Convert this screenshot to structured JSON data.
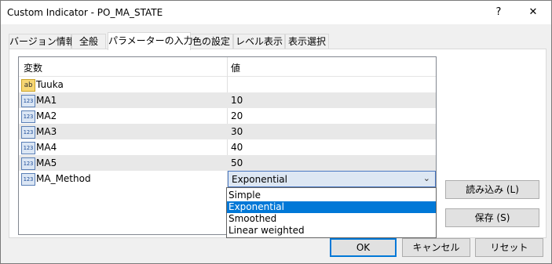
{
  "window": {
    "title": "Custom Indicator - PO_MA_STATE",
    "help_label": "?",
    "close_label": "✕"
  },
  "tabs": [
    {
      "label": "バージョン情報"
    },
    {
      "label": "全般"
    },
    {
      "label": "パラメーターの入力"
    },
    {
      "label": "色の設定"
    },
    {
      "label": "レベル表示"
    },
    {
      "label": "表示選択"
    }
  ],
  "grid": {
    "header_name": "変数",
    "header_value": "値",
    "rows": [
      {
        "icon": "ab",
        "name": "Tuuka",
        "value": ""
      },
      {
        "icon": "123",
        "name": "MA1",
        "value": "10"
      },
      {
        "icon": "123",
        "name": "MA2",
        "value": "20"
      },
      {
        "icon": "123",
        "name": "MA3",
        "value": "30"
      },
      {
        "icon": "123",
        "name": "MA4",
        "value": "40"
      },
      {
        "icon": "123",
        "name": "MA5",
        "value": "50"
      },
      {
        "icon": "123",
        "name": "MA_Method",
        "value": "Exponential"
      }
    ]
  },
  "dropdown": {
    "options": [
      "Simple",
      "Exponential",
      "Smoothed",
      "Linear weighted"
    ],
    "selected": "Exponential"
  },
  "buttons": {
    "load": "読み込み (L)",
    "save": "保存 (S)",
    "ok": "OK",
    "cancel": "キャンセル",
    "reset": "リセット"
  },
  "colors": {
    "selection": "#0078d7",
    "alt_row": "#e8e8e8"
  }
}
